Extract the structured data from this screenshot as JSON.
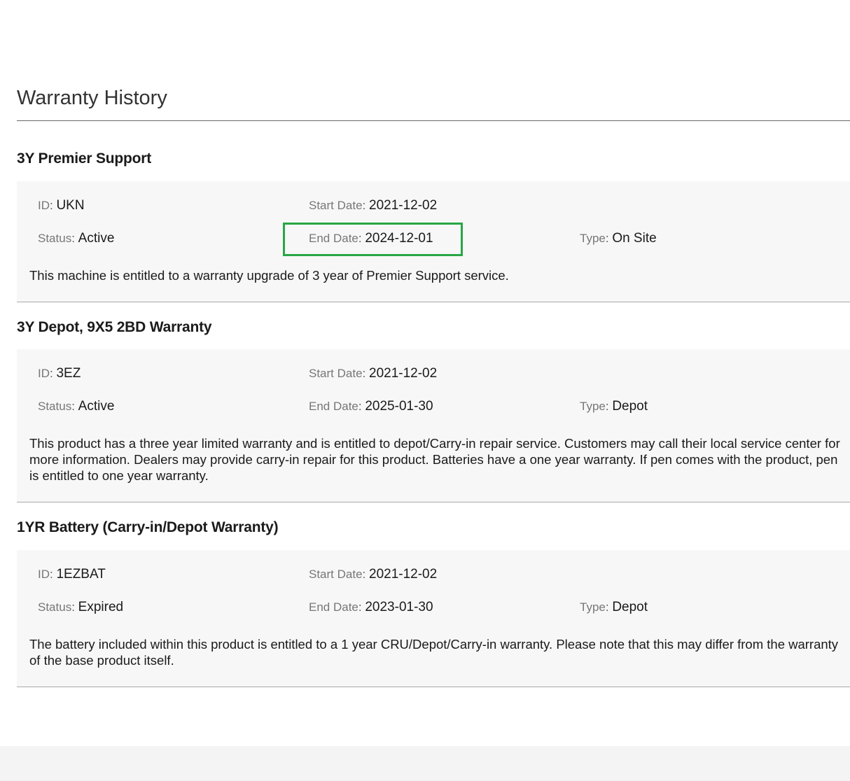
{
  "page_title": "Warranty History",
  "labels": {
    "id": "ID",
    "status": "Status",
    "start_date": "Start Date",
    "end_date": "End Date",
    "type": "Type",
    "separator": ": "
  },
  "highlight_color": "#28a745",
  "warranties": [
    {
      "title": "3Y Premier Support",
      "id": "UKN",
      "status": "Active",
      "start_date": "2021-12-02",
      "end_date": "2024-12-01",
      "type": "On Site",
      "description": "This machine is entitled to a warranty upgrade of 3 year of Premier Support service.",
      "end_date_highlighted": true
    },
    {
      "title": "3Y Depot, 9X5 2BD Warranty",
      "id": "3EZ",
      "status": "Active",
      "start_date": "2021-12-02",
      "end_date": "2025-01-30",
      "type": "Depot",
      "description": "This product has a three year limited warranty and is entitled to depot/Carry-in repair service. Customers may call their local service center for more information. Dealers may provide carry-in repair for this product. Batteries have a one year warranty. If pen comes with the product, pen is entitled to one year warranty."
    },
    {
      "title": "1YR Battery (Carry-in/Depot Warranty)",
      "id": "1EZBAT",
      "status": "Expired",
      "start_date": "2021-12-02",
      "end_date": "2023-01-30",
      "type": "Depot",
      "description": "The battery included within this product is entitled to a 1 year CRU/Depot/Carry-in warranty. Please note that this may differ from the warranty of the base product itself."
    }
  ]
}
